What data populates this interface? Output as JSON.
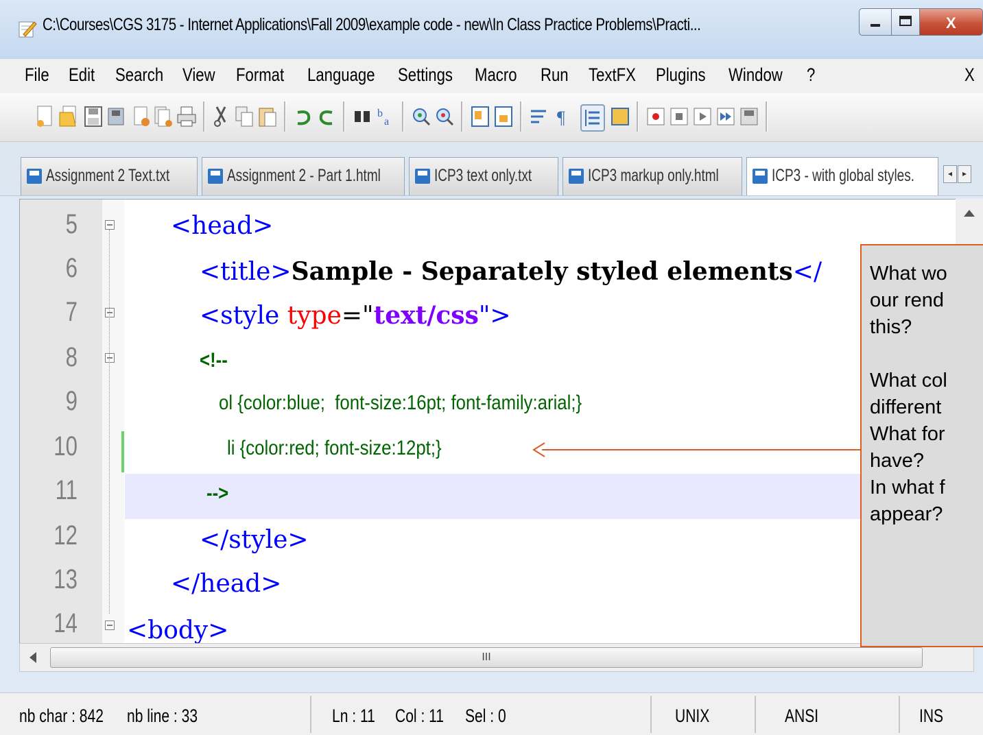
{
  "window": {
    "title": "C:\\Courses\\CGS 3175 - Internet Applications\\Fall 2009\\example code - new\\In Class Practice Problems\\Practi..."
  },
  "menu": {
    "items": [
      "File",
      "Edit",
      "Search",
      "View",
      "Format",
      "Language",
      "Settings",
      "Macro",
      "Run",
      "TextFX",
      "Plugins",
      "Window",
      "?"
    ],
    "close_doc": "X"
  },
  "tabs": [
    {
      "label": "Assignment 2 Text.txt"
    },
    {
      "label": "Assignment 2 - Part 1.html"
    },
    {
      "label": "ICP3 text only.txt"
    },
    {
      "label": "ICP3 markup only.html"
    },
    {
      "label": "ICP3 -  with global styles."
    }
  ],
  "editor": {
    "line_numbers": [
      "5",
      "6",
      "7",
      "8",
      "9",
      "10",
      "11",
      "12",
      "13",
      "14"
    ],
    "lines": {
      "l5": "<head>",
      "l6_open": "<title>",
      "l6_text": "Sample - Separately styled elements",
      "l6_close": "</",
      "l7_tag": "<style ",
      "l7_attr": "type",
      "l7_eq": "=\"",
      "l7_val": "text/css",
      "l7_end": "\">",
      "l8": "<!--",
      "l9": "ol {color:blue;  font-size:16pt; font-family:arial;}",
      "l10": "li {color:red; font-size:12pt;}",
      "l11": "-->",
      "l12": "</style>",
      "l13": "</head>",
      "l14": "<body>"
    },
    "hscroll_grip": "III"
  },
  "status": {
    "nb_char": "nb char : 842",
    "nb_line": "nb line : 33",
    "ln": "Ln : 11",
    "col": "Col : 11",
    "sel": "Sel : 0",
    "eol": "UNIX",
    "encoding": "ANSI",
    "mode": "INS"
  },
  "callout": {
    "text": "What wo\nour rend\nthis?\n\nWhat col\ndifferent\nWhat for\nhave?\nIn what f\nappear?"
  },
  "colors": {
    "callout_border": "#e05a24",
    "highlight_line": "#e8e8ff",
    "tag_blue": "#0000ff",
    "attr_red": "#ff0000",
    "value_purple": "#8000ff",
    "css_green": "#006400"
  }
}
